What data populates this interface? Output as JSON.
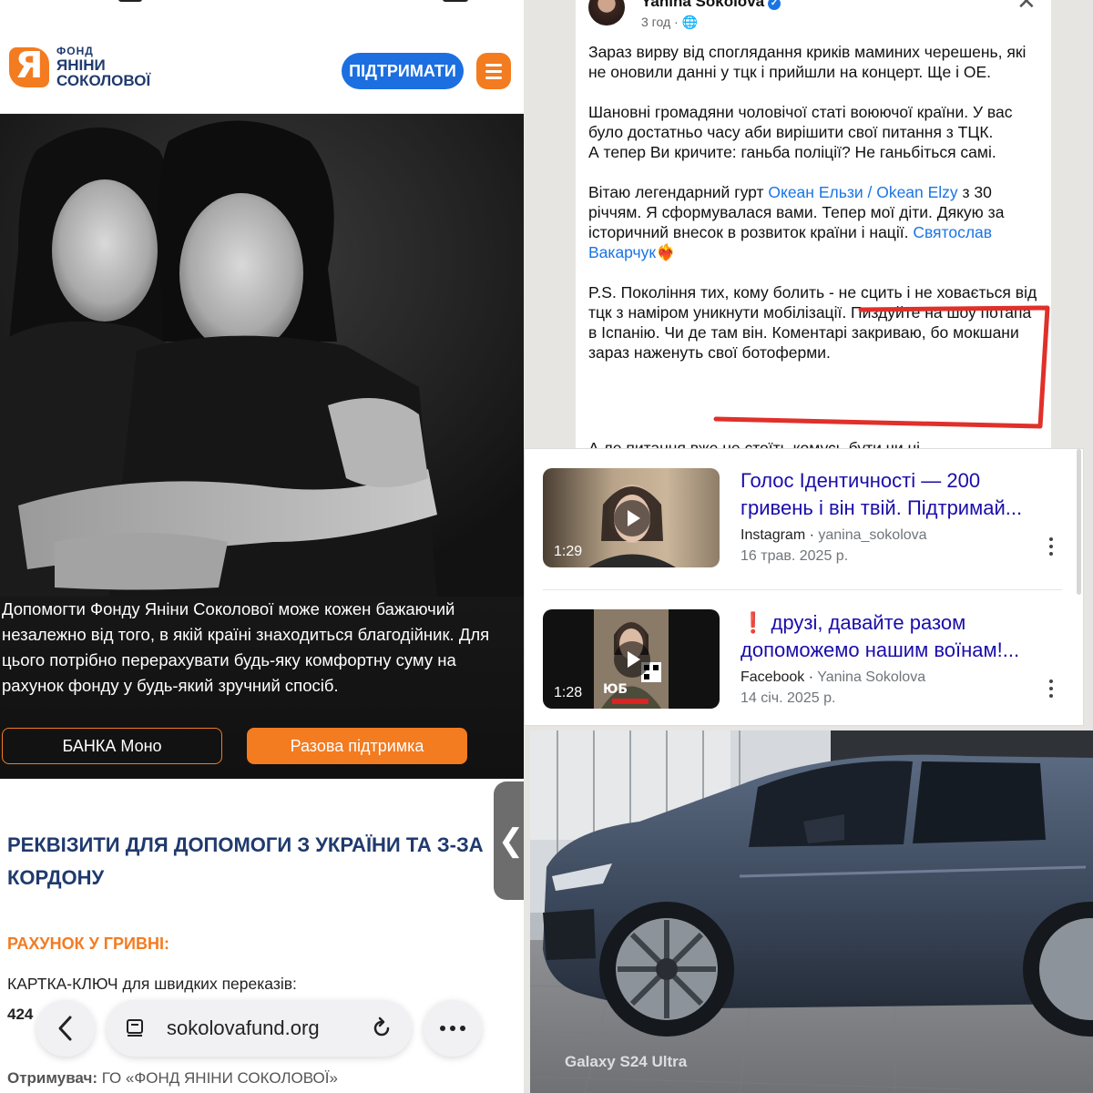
{
  "website": {
    "logo": {
      "line1": "ФОНД",
      "line2": "ЯНІНИ",
      "line3": "СОКОЛОВОЇ",
      "mark": "Я"
    },
    "support_button": "ПІДТРИМАТИ",
    "menu_icon": "hamburger-icon",
    "hero_text": "Допомогти Фонду Яніни Соколової може кожен бажаючий незалежно від того, в якій країні знаходиться благодійник. Для цього потрібно перерахувати будь-яку комфортну суму на рахунок фонду у будь-який зручний спосіб.",
    "buttons": {
      "bank": "БАНКА Моно",
      "one_time": "Разова підтримка"
    },
    "requisites_title": "РЕКВІЗИТИ ДЛЯ ДОПОМОГИ З УКРАЇНИ ТА З-ЗА КОРДОНУ",
    "account_title": "РАХУНОК У ГРИВНІ:",
    "card_label": "КАРТКА-КЛЮЧ для швидких переказів:",
    "card_number": "424",
    "recipient_label": "Отримувач:",
    "recipient_value": "ГО «ФОНД ЯНІНИ СОКОЛОВОЇ»",
    "side_tab": "❮"
  },
  "browser": {
    "url": "sokolovafund.org",
    "back_icon": "back-arrow-icon",
    "tabs_icon": "tabs-icon",
    "reload_icon": "reload-icon",
    "more_icon": "more-dots-icon"
  },
  "facebook_post": {
    "author": "Yanina Sokolova",
    "time": "3 год · 🌐",
    "paragraph1": "Зараз вирву від споглядання криків маминих черешень, які не оновили данні у тцк і прийшли на концерт. Ще і ОЕ.",
    "paragraph2": "Шановні громадяни чоловічої статі воюючої країни. У вас було достатньо часу аби вирішити свої питання з ТЦК.\nА тепер Ви кричите: ганьба поліції? Не ганьбіться самі.",
    "p3_before": "Вітаю легендарний гурт ",
    "p3_link1": "Океан Ельзи / Okean Elzy",
    "p3_middle": "  з 30 річчям. Я сформувалася вами. Тепер мої діти. Дякую за історичний внесок в розвиток країни і нації. ",
    "p3_link2": "Святослав Вакарчук",
    "p3_emoji": "❤️‍🔥",
    "paragraph4": "P.S. Покоління тих, кому болить - не сцить і не ховається від тцк з наміром уникнути мобілізації. Пиздуйте на шоу потапа в Іспанію. Чи де там він. Коментарі закриваю, бо мокшани зараз наженуть свої ботоферми.",
    "cut_line": "А ле питання вже не стоїть комусь бути чи ні"
  },
  "search_results": [
    {
      "title": "Голос Ідентичності — 200 гривень і він твій. Підтримай...",
      "source": "Instagram",
      "account": "yanina_sokolova",
      "date": "16 трав. 2025 р.",
      "duration": "1:29",
      "prefix": ""
    },
    {
      "title": "друзі, давайте разом допоможемо нашим воїнам!...",
      "source": "Facebook",
      "account": "Yanina Sokolova",
      "date": "14 січ. 2025 р.",
      "duration": "1:28",
      "prefix": "❗"
    }
  ],
  "photo": {
    "watermark": "Galaxy S24 Ultra"
  }
}
